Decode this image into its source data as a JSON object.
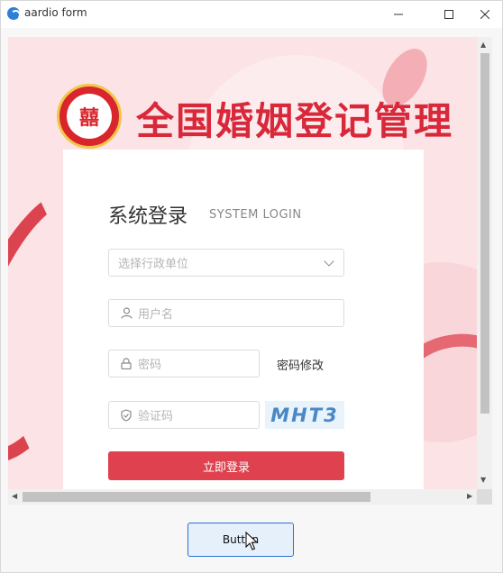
{
  "window": {
    "title": "aardio form",
    "icon": "aardio-app-icon",
    "controls": {
      "minimize_icon": "minimize-icon",
      "maximize_icon": "maximize-icon",
      "close_icon": "close-icon"
    }
  },
  "banner": {
    "title": "全国婚姻登记管理",
    "emblem_text": "囍",
    "emblem_icon": "marriage-registration-emblem"
  },
  "login": {
    "title": "系统登录",
    "subtitle": "SYSTEM LOGIN",
    "unit_select": {
      "placeholder": "选择行政单位",
      "icon": "chevron-down-icon"
    },
    "username": {
      "placeholder": "用户名",
      "icon": "user-icon"
    },
    "password": {
      "placeholder": "密码",
      "icon": "lock-icon"
    },
    "change_password_label": "密码修改",
    "captcha": {
      "placeholder": "验证码",
      "icon": "shield-icon",
      "code": "MHT3"
    },
    "submit_label": "立即登录"
  },
  "action_button_label": "Button",
  "colors": {
    "primary": "#e0414f",
    "banner_text": "#d8283a",
    "captcha_text": "#4a88c4",
    "button_border": "#2a6fd6"
  }
}
